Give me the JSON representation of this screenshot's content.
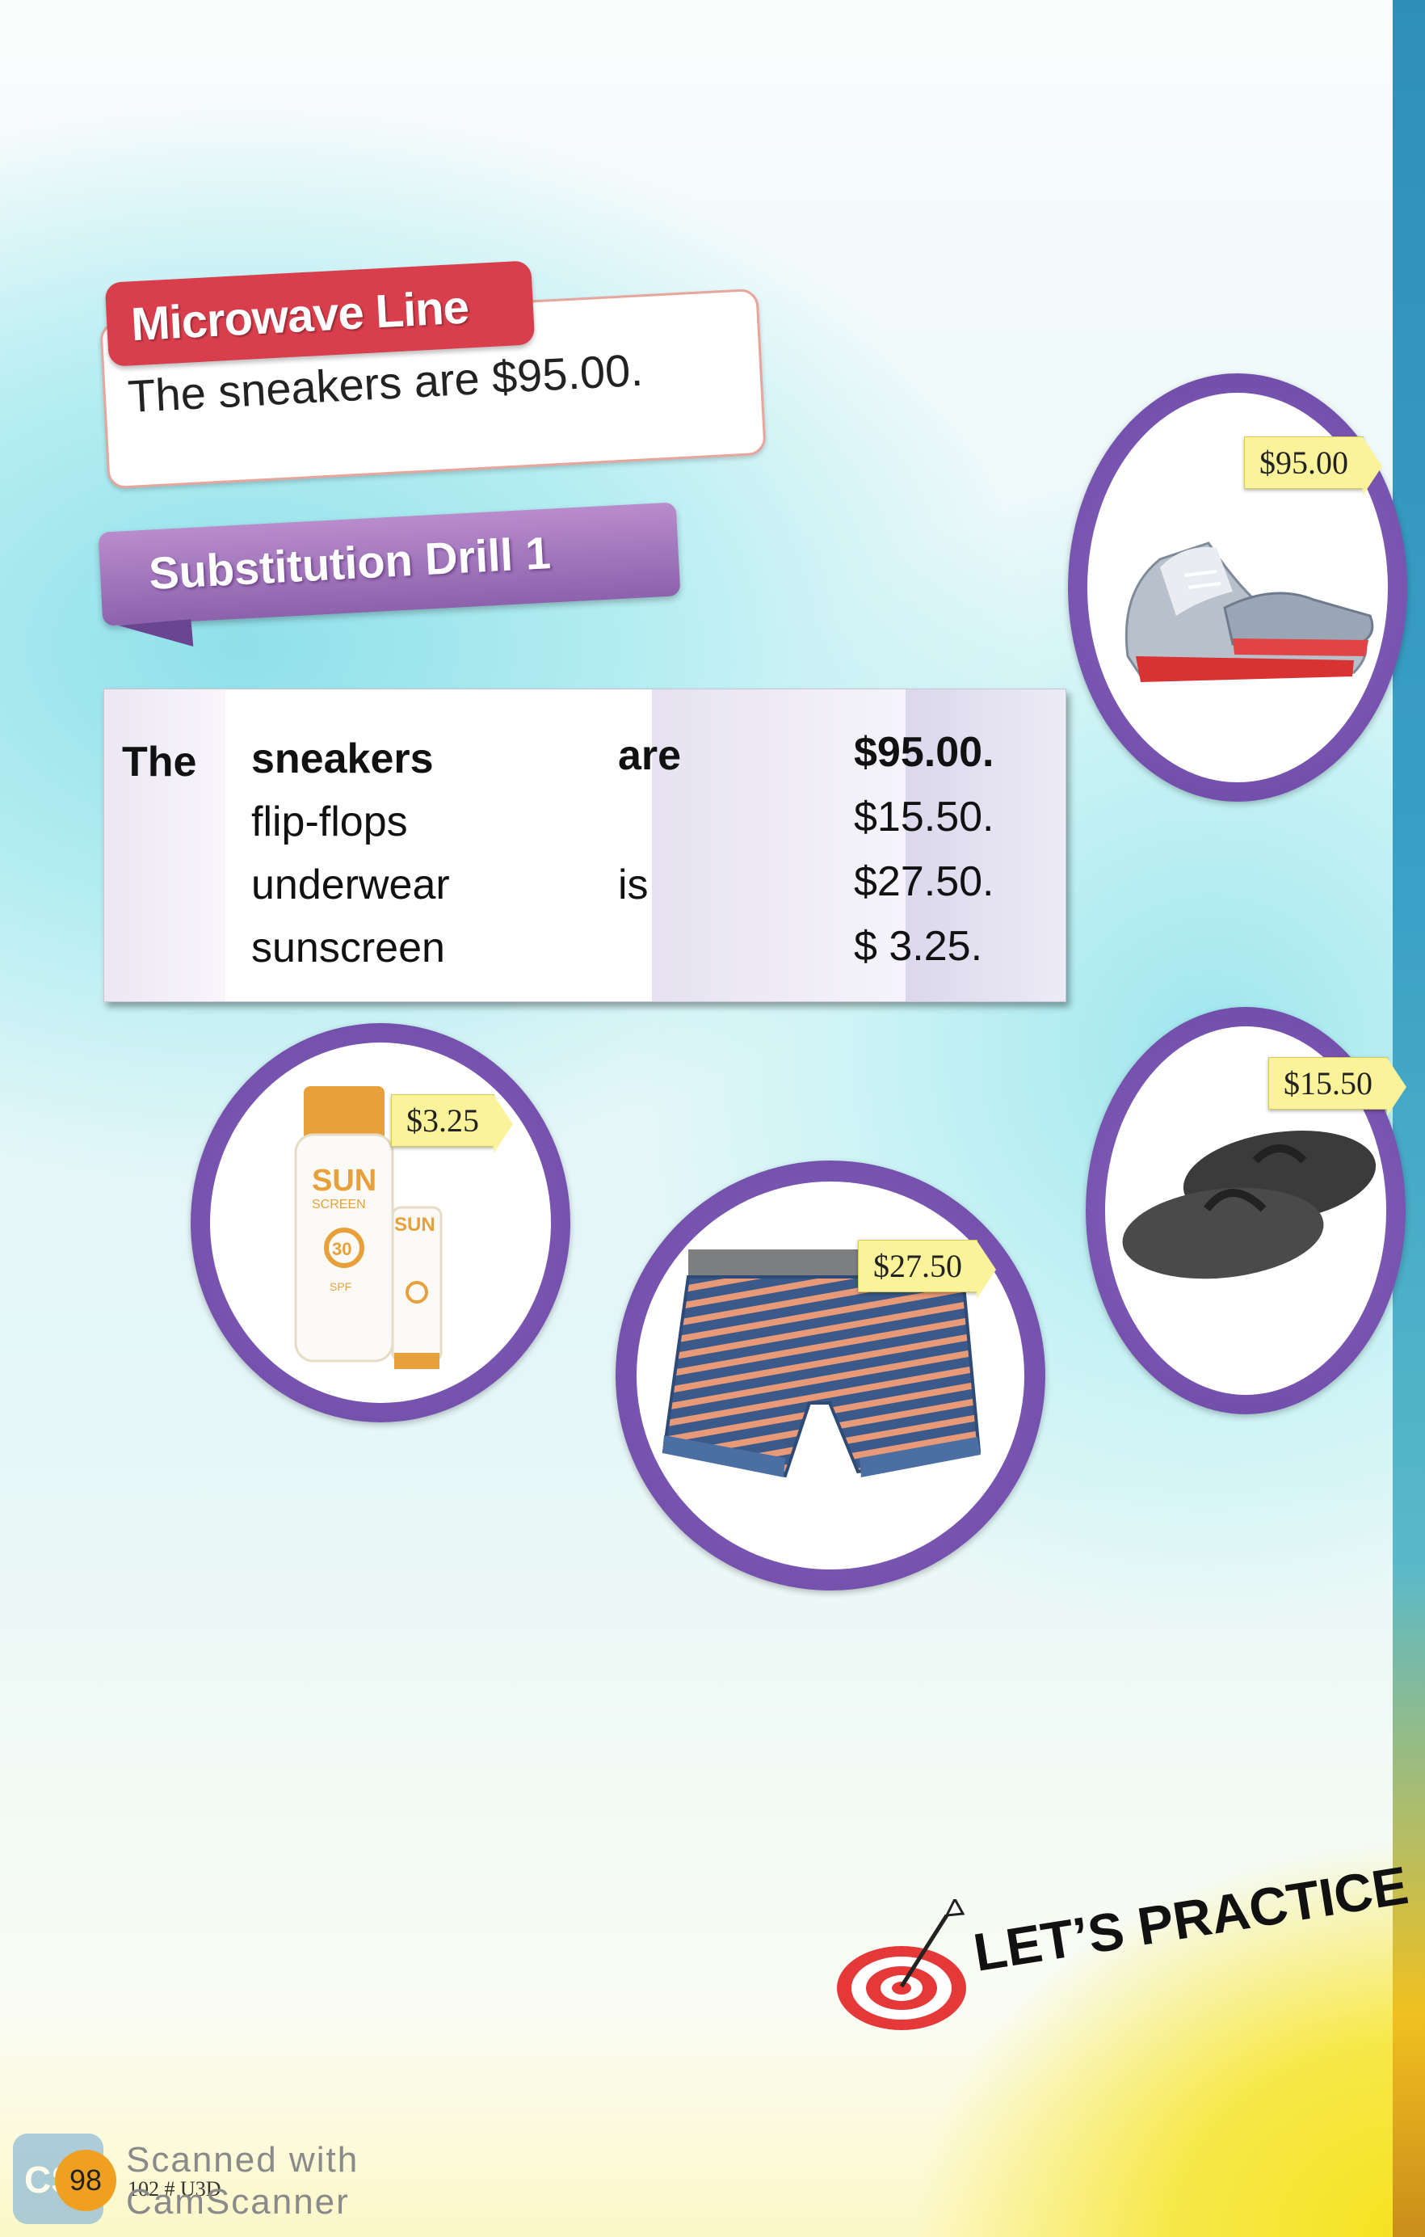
{
  "microwave_line": {
    "title": "Microwave Line",
    "sentence": "The sneakers are $95.00."
  },
  "substitution": {
    "title": "Substitution Drill 1"
  },
  "drill_table": {
    "the": "The",
    "items": [
      "sneakers",
      "flip-flops",
      "underwear",
      "sunscreen"
    ],
    "verbs": [
      "are",
      "",
      "is",
      ""
    ],
    "prices": [
      "$95.00.",
      "$15.50.",
      "$27.50.",
      "$  3.25."
    ]
  },
  "products": {
    "sneakers_price": "$95.00",
    "flipflops_price": "$15.50",
    "underwear_price": "$27.50",
    "sunscreen_price": "$3.25",
    "sunscreen_label_big": "SUN",
    "sunscreen_label_sub": "SCREEN",
    "sunscreen_spf": "30",
    "sunscreen_spf_word": "SPF"
  },
  "footer": {
    "lets_practice": "LET’S PRACTICE",
    "page_number": "98",
    "code": "102 # U3D",
    "watermark_line1": "Scanned with",
    "watermark_line2": "CamScanner",
    "watermark_logo": "CS"
  },
  "colors": {
    "microwave_red": "#d93e4c",
    "ribbon_purple": "#8d62ad",
    "tag_yellow": "#fbf39a",
    "circle_purple": "#6b47a6"
  }
}
